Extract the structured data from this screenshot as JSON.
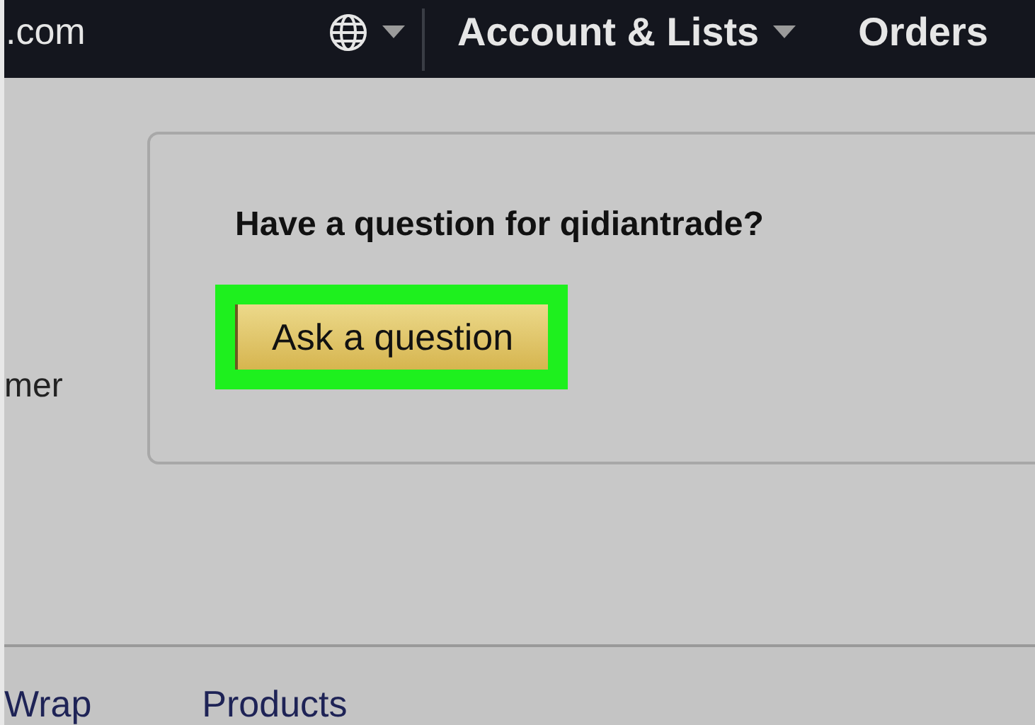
{
  "top_bar": {
    "domain": ".com",
    "account": "Account & Lists",
    "orders": "Orders"
  },
  "side_text": "mer",
  "question_card": {
    "heading": "Have a question for qidiantrade?",
    "button": {
      "label": "Ask a question",
      "highlighted": true
    }
  },
  "footer_links": [
    "Wrap",
    "Products"
  ]
}
